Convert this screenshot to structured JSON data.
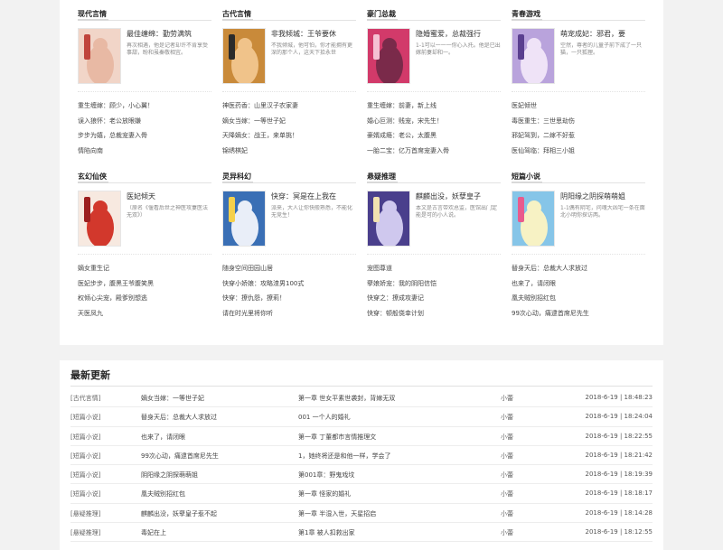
{
  "colors": {
    "background": "#f2f2f2",
    "panel": "#ffffff",
    "divider": "#e3e3e3"
  },
  "categories": [
    {
      "title": "现代言情",
      "featured": {
        "title": "最佳缠绵：勤劳满筑",
        "desc": "再次相遇，他是记者却许不肯享受事甜，盼和虽秦敬相宜。"
      },
      "cover": {
        "bg": "#f1d5c8",
        "accent": "#c0453d",
        "figure": "#e8b9a4"
      },
      "list": [
        "重生缠嫁：顾少，小心翼！",
        "误入狼怀：老公放眼嫌",
        "步步为嬉，总裁宠妻入骨",
        "情陷向南"
      ]
    },
    {
      "title": "古代言情",
      "featured": {
        "title": "非我倾城：王爷要休",
        "desc": "不我倾城，他可怕，你才能拥有更深的那个人，这天下拾永世"
      },
      "cover": {
        "bg": "#c98a3a",
        "accent": "#2b2b2b",
        "figure": "#f0c38a"
      },
      "list": [
        "神医药香：山里汉子农家妻",
        "嫡女当嫁：一等世子妃",
        "天降嫡女：战王，来单挑！",
        "锦绣棋妃"
      ]
    },
    {
      "title": "豪门总裁",
      "featured": {
        "title": "隐婚蜜爱，总裁强行",
        "desc": "1-1可以一一一你心入托。他是已出嫁前妻却和一。"
      },
      "cover": {
        "bg": "#d23a6a",
        "accent": "#f5c1d3",
        "figure": "#7a2a4a"
      },
      "list": [
        "重生缠嫁：前妻，新上线",
        "婚心叵测：贱宠，宋先生！",
        "豪婿成瘾：老公，太腹黑",
        "一胎二宝：亿万首席宠妻入骨"
      ]
    },
    {
      "title": "青春游戏",
      "featured": {
        "title": "萌宠成妃：邪君，要",
        "desc": "空然，尊者的儿童子前下成了一只猫，一只狐狸。"
      },
      "cover": {
        "bg": "#b9a3dc",
        "accent": "#5a3f8f",
        "figure": "#efe3f7"
      },
      "list": [
        "医妃倾世",
        "毒医重生：三世思劫伤",
        "邪妃驾到，二嫁不好惹",
        "医仙驾临：拜相三小姐"
      ]
    },
    {
      "title": "玄幻仙侠",
      "featured": {
        "title": "医妃倾天",
        "desc": "（原名《偃看后世之神医攻妻医法无双》）"
      },
      "cover": {
        "bg": "#f7e9e0",
        "accent": "#9c1f1f",
        "figure": "#d2382c"
      },
      "list": [
        "嫡女重生记",
        "医妃步步，腹黑王爷腹笑黑",
        "权倾心尖宠，殿爹别想逃",
        "天医凤九"
      ]
    },
    {
      "title": "灵异科幻",
      "featured": {
        "title": "快穿：冥是在上我在",
        "desc": "派来，大人让你快般熟悉，不能化无竞生！"
      },
      "cover": {
        "bg": "#3a6fb5",
        "accent": "#f5d04b",
        "figure": "#e9eef8"
      },
      "list": [
        "随身空间田园山居",
        "快穿小娇娘：攻略渣男100式",
        "快穿：撩仇怨，撩莉！",
        "请在时光里将你听"
      ]
    },
    {
      "title": "悬疑推理",
      "featured": {
        "title": "麒麟出没，妖孽皇子",
        "desc": "本文是古言带欢总监，医馆出门定能是可的小人说。"
      },
      "cover": {
        "bg": "#4a3f8c",
        "accent": "#f2e2b0",
        "figure": "#cfc8ee"
      },
      "list": [
        "宠图尊道",
        "孽娘娇宠：我的阴阳信恺",
        "快穿之：撩成攻妻记",
        "快穿：顿般侥幸计划"
      ]
    },
    {
      "title": "短篇小说",
      "featured": {
        "title": "阴阳缘之阴探萌萌姐",
        "desc": "1-1偶有阴宅，问魂大凶宅一条在面北小明你探访两。"
      },
      "cover": {
        "bg": "#86c5e8",
        "accent": "#e85b8d",
        "figure": "#f7f2c4"
      },
      "list": [
        "替身天后：总裁大人求放过",
        "也来了，请闭眼",
        "凰夫贼别招红包",
        "99次心动，痛逮首席尼先生"
      ]
    }
  ],
  "latest": {
    "title": "最新更新",
    "rows": [
      {
        "category": "[古代言情]",
        "book": "嫡女当嫁：一等世子妃",
        "chapter": "第一章 世女平素世袭封，背嫁无双",
        "author": "小蕾",
        "time": "2018-6-19 | 18:48:23"
      },
      {
        "category": "[短篇小说]",
        "book": "替身天后：总裁大人求放过",
        "chapter": "001 一个人的婚礼",
        "author": "小蕾",
        "time": "2018-6-19 | 18:24:04"
      },
      {
        "category": "[短篇小说]",
        "book": "也来了，请闭眼",
        "chapter": "第一章 丁董都市言情推理文",
        "author": "小蕾",
        "time": "2018-6-19 | 18:22:55"
      },
      {
        "category": "[短篇小说]",
        "book": "99次心动，痛逮首席尼先生",
        "chapter": "1，她终将还是和他一样，学会了",
        "author": "小蕾",
        "time": "2018-6-19 | 18:21:42"
      },
      {
        "category": "[短篇小说]",
        "book": "阴阳缘之阴探萌萌姐",
        "chapter": "第001章：野鬼戏坟",
        "author": "小蕾",
        "time": "2018-6-19 | 18:19:39"
      },
      {
        "category": "[短篇小说]",
        "book": "凰夫贼别招红包",
        "chapter": "第一章 怪家的婚礼",
        "author": "小蕾",
        "time": "2018-6-19 | 18:18:17"
      },
      {
        "category": "[悬疑推理]",
        "book": "麒麟出没，妖孽皇子惹不起",
        "chapter": "第一章 半湿入世，天星招启",
        "author": "小蕾",
        "time": "2018-6-19 | 18:14:28"
      },
      {
        "category": "[悬疑推理]",
        "book": "毒妃在上",
        "chapter": "第1章 被人扣救出家",
        "author": "小蕾",
        "time": "2018-6-19 | 18:12:55"
      }
    ]
  }
}
